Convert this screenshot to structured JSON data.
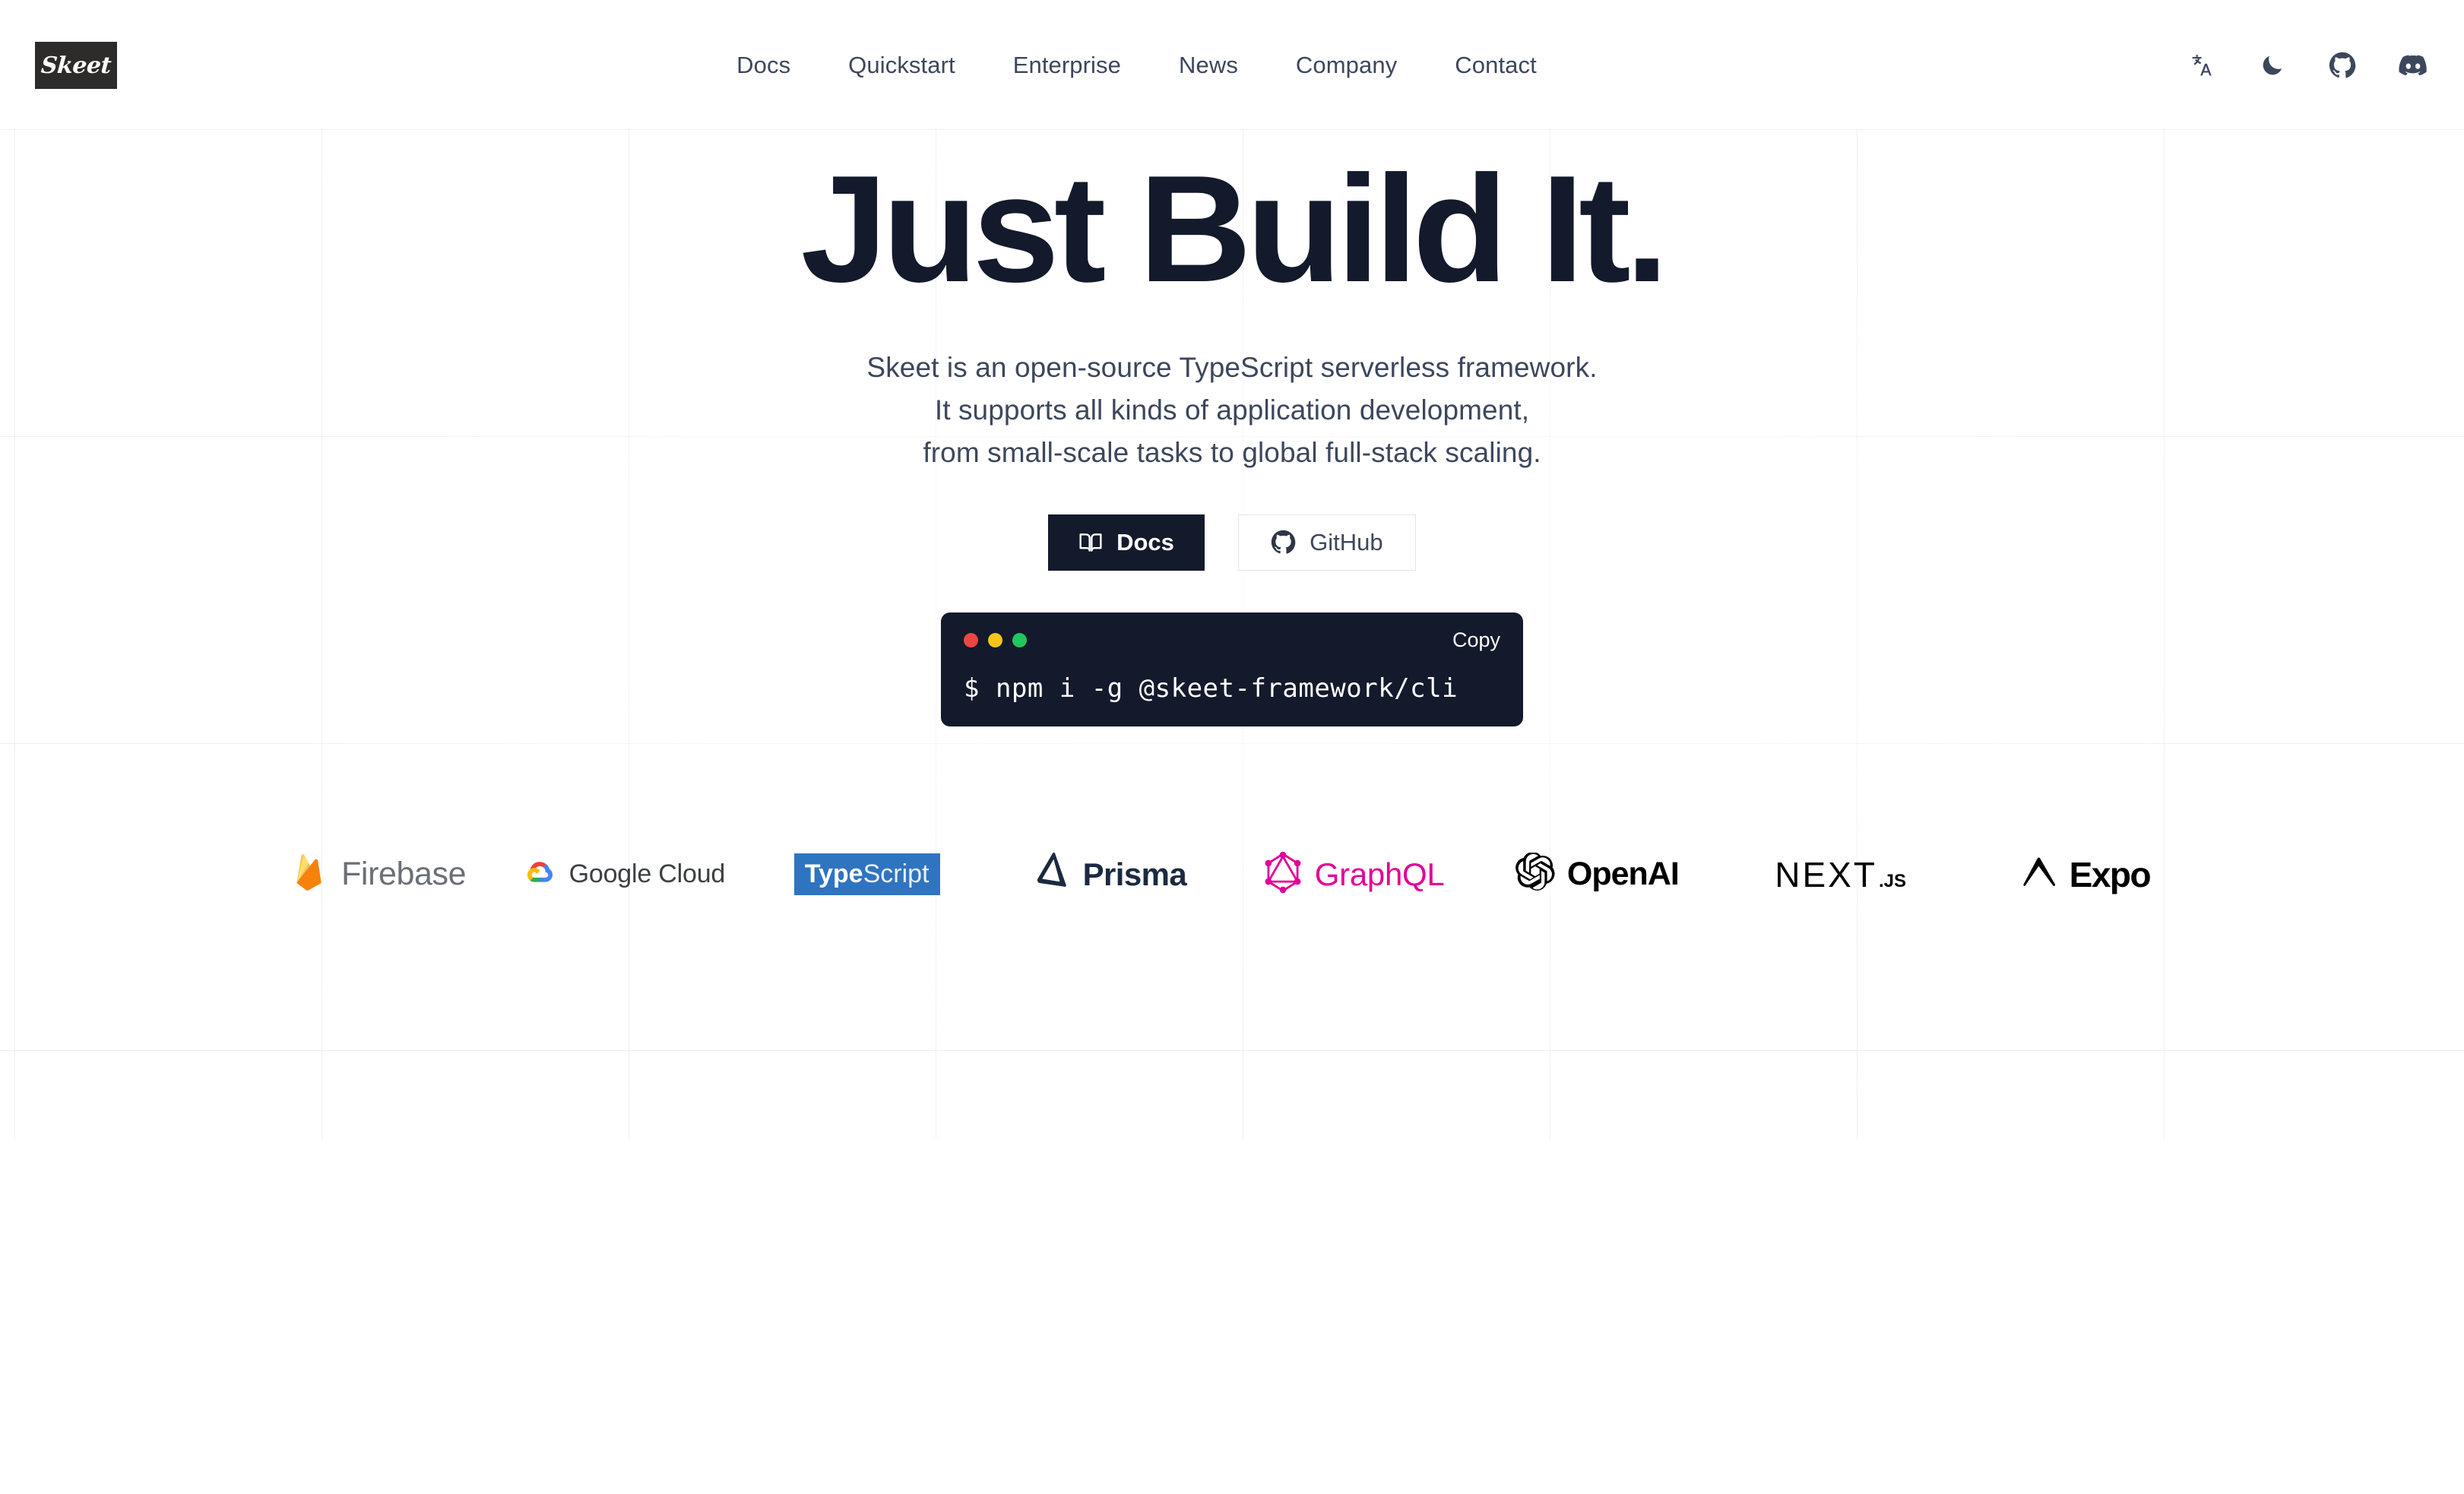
{
  "header": {
    "logo_text": "Skeet",
    "nav": [
      {
        "label": "Docs"
      },
      {
        "label": "Quickstart"
      },
      {
        "label": "Enterprise"
      },
      {
        "label": "News"
      },
      {
        "label": "Company"
      },
      {
        "label": "Contact"
      }
    ],
    "icons": [
      {
        "name": "language-icon"
      },
      {
        "name": "moon-icon"
      },
      {
        "name": "github-icon"
      },
      {
        "name": "discord-icon"
      }
    ]
  },
  "hero": {
    "headline": "Just Build It.",
    "subtitle_line1": "Skeet is an open-source TypeScript serverless framework.",
    "subtitle_line2": "It supports all kinds of application development,",
    "subtitle_line3": "from small-scale tasks to global full-stack scaling.",
    "primary_button": "Docs",
    "secondary_button": "GitHub"
  },
  "terminal": {
    "copy_label": "Copy",
    "command": "$ npm i -g @skeet-framework/cli",
    "dots": [
      "#ef4444",
      "#f5c518",
      "#22c55e"
    ]
  },
  "logos": [
    {
      "name": "firebase",
      "label": "Firebase"
    },
    {
      "name": "google-cloud",
      "label": "Google Cloud"
    },
    {
      "name": "typescript",
      "label_bold": "Type",
      "label_light": "Script"
    },
    {
      "name": "prisma",
      "label": "Prisma"
    },
    {
      "name": "graphql",
      "label": "GraphQL"
    },
    {
      "name": "openai",
      "label": "OpenAI"
    },
    {
      "name": "nextjs",
      "label": "NEXT",
      "suffix": ".JS"
    },
    {
      "name": "expo",
      "label": "Expo"
    }
  ],
  "colors": {
    "dark_navy": "#131a2b",
    "body_text": "#3d475c",
    "typescript_blue": "#2f74c0",
    "graphql_pink": "#e10098"
  }
}
